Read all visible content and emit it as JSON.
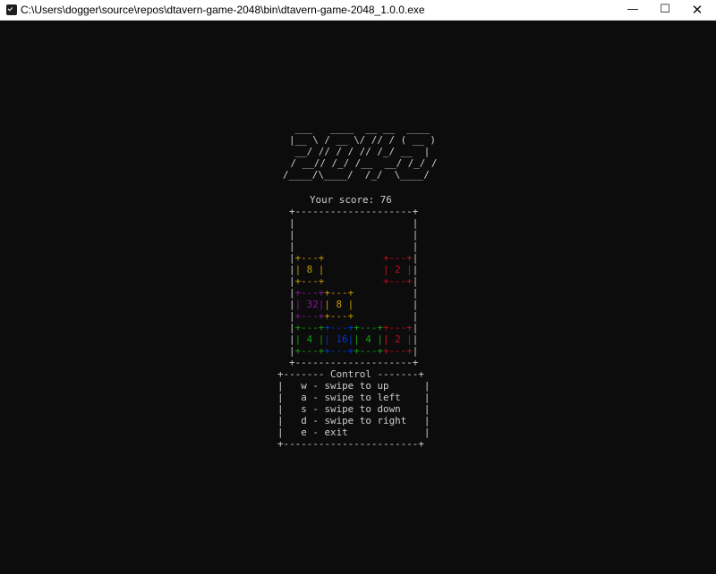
{
  "window": {
    "title": "C:\\Users\\dogger\\source\\repos\\dtavern-game-2048\\bin\\dtavern-game-2048_1.0.0.exe",
    "minimize_glyph": "—",
    "maximize_glyph": "☐",
    "close_glyph": "✕",
    "icon": "console-app-icon"
  },
  "logo": {
    "lines": [
      " ___   ____  __ __  ____",
      "|__ \\ / __ \\/ // / ( __ )",
      " __/ // / / // /_/ __  |",
      " / __// /_/ /__  __/ /_/ /",
      "/____/\\____/  /_/  \\____/"
    ]
  },
  "score": {
    "label": "Your score:",
    "value": "76"
  },
  "board": {
    "top_border": "+--------------------+",
    "bottom_border": "+--------------------+",
    "empty_rows": [
      "|                    |",
      "|                    |",
      "|                    |"
    ],
    "rows": [
      {
        "top": [
          {
            "t": "|",
            "c": ""
          },
          {
            "t": "+---+",
            "c": "yellow"
          },
          {
            "t": "          ",
            "c": ""
          },
          {
            "t": "+---+",
            "c": "red"
          },
          {
            "t": "|",
            "c": ""
          }
        ],
        "mid": [
          {
            "t": "|",
            "c": ""
          },
          {
            "t": "| 8 |",
            "c": "yellow"
          },
          {
            "t": "          ",
            "c": ""
          },
          {
            "t": "| 2 |",
            "c": "red"
          },
          {
            "t": "|",
            "c": ""
          }
        ],
        "bot": [
          {
            "t": "|",
            "c": ""
          },
          {
            "t": "+---+",
            "c": "yellow"
          },
          {
            "t": "          ",
            "c": ""
          },
          {
            "t": "+---+",
            "c": "red"
          },
          {
            "t": "|",
            "c": ""
          }
        ]
      },
      {
        "top": [
          {
            "t": "|",
            "c": ""
          },
          {
            "t": "+---+",
            "c": "purple"
          },
          {
            "t": "+---+",
            "c": "yellow"
          },
          {
            "t": "          ",
            "c": ""
          },
          {
            "t": "|",
            "c": ""
          }
        ],
        "mid": [
          {
            "t": "|",
            "c": ""
          },
          {
            "t": "| 32|",
            "c": "purple"
          },
          {
            "t": "| 8 |",
            "c": "yellow"
          },
          {
            "t": "          ",
            "c": ""
          },
          {
            "t": "|",
            "c": ""
          }
        ],
        "bot": [
          {
            "t": "|",
            "c": ""
          },
          {
            "t": "+---+",
            "c": "purple"
          },
          {
            "t": "+---+",
            "c": "yellow"
          },
          {
            "t": "          ",
            "c": ""
          },
          {
            "t": "|",
            "c": ""
          }
        ]
      },
      {
        "top": [
          {
            "t": "|",
            "c": ""
          },
          {
            "t": "+---+",
            "c": "green"
          },
          {
            "t": "+---+",
            "c": "blue"
          },
          {
            "t": "+---+",
            "c": "green"
          },
          {
            "t": "+---+",
            "c": "red"
          },
          {
            "t": "|",
            "c": ""
          }
        ],
        "mid": [
          {
            "t": "|",
            "c": ""
          },
          {
            "t": "| 4 |",
            "c": "green"
          },
          {
            "t": "| 16|",
            "c": "blue"
          },
          {
            "t": "| 4 |",
            "c": "green"
          },
          {
            "t": "| 2 |",
            "c": "red"
          },
          {
            "t": "|",
            "c": ""
          }
        ],
        "bot": [
          {
            "t": "|",
            "c": ""
          },
          {
            "t": "+---+",
            "c": "green"
          },
          {
            "t": "+---+",
            "c": "blue"
          },
          {
            "t": "+---+",
            "c": "green"
          },
          {
            "t": "+---+",
            "c": "red"
          },
          {
            "t": "|",
            "c": ""
          }
        ]
      }
    ]
  },
  "controls": {
    "header": "+------- Control -------+",
    "items": [
      "|   w - swipe to up      |",
      "|   a - swipe to left    |",
      "|   s - swipe to down    |",
      "|   d - swipe to right   |",
      "|   e - exit             |"
    ],
    "footer": "+-----------------------+"
  },
  "colors": {
    "background": "#0c0c0c",
    "text": "#cccccc",
    "yellow": "#c19c00",
    "red": "#c50f1f",
    "purple": "#881798",
    "green": "#13a10e",
    "blue": "#0037da"
  }
}
